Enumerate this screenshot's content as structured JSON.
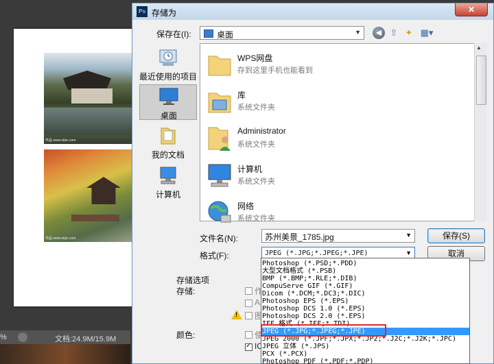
{
  "photoshop": {
    "status_percent": "%",
    "status_doc": "文档:24.9M/15.9M",
    "photo_caption": "作品 www.nipic.com"
  },
  "dialog": {
    "title": "存储为",
    "ps_badge": "Ps",
    "close_glyph": "✕",
    "save_in_label": "保存在(I):",
    "save_in_value": "桌面",
    "places": [
      {
        "label": "最近使用的项目"
      },
      {
        "label": "桌面"
      },
      {
        "label": "我的文档"
      },
      {
        "label": "计算机"
      }
    ],
    "items": [
      {
        "name": "WPS网盘",
        "sub": "存到这里手机也能看到"
      },
      {
        "name": "库",
        "sub": "系统文件夹"
      },
      {
        "name": "Administrator",
        "sub": "系统文件夹"
      },
      {
        "name": "计算机",
        "sub": "系统文件夹"
      },
      {
        "name": "网络",
        "sub": "系统文件夹"
      }
    ],
    "filename_label": "文件名(N):",
    "filename_value": "苏州美景_1785.jpg",
    "format_label": "格式(F):",
    "format_value": "JPEG (*.JPG;*.JPEG;*.JPE)",
    "save_button": "保存(S)",
    "cancel_button": "取消",
    "save_options_title": "存储选项",
    "save_label": "存储:",
    "color_label": "颜色:",
    "opt_partial_1": "作",
    "opt_partial_2": "A",
    "opt_partial_3": "图",
    "opt_partial_4": "使",
    "opt_partial_5": "IC",
    "warning_glyph": "!"
  },
  "format_options": [
    "Photoshop (*.PSD;*.PDD)",
    "大型文档格式 (*.PSB)",
    "BMP (*.BMP;*.RLE;*.DIB)",
    "CompuServe GIF (*.GIF)",
    "Dicom (*.DCM;*.DC3;*.DIC)",
    "Photoshop EPS (*.EPS)",
    "Photoshop DCS 1.0 (*.EPS)",
    "Photoshop DCS 2.0 (*.EPS)",
    "IFF 格式 (*.IFF;*.TDI)",
    "JPEG (*.JPG;*.JPEG;*.JPE)",
    "JPEG 2000 (*.JPF;*.JPX;*.JP2;*.J2C;*.J2K;*.JPC)",
    "JPEG 立体 (*.JPS)",
    "PCX (*.PCX)",
    "Photoshop PDF (*.PDF;*.PDP)"
  ],
  "selected_format_index": 9,
  "colors": {
    "selection": "#3399ff",
    "highlight_box": "#e0262c"
  }
}
